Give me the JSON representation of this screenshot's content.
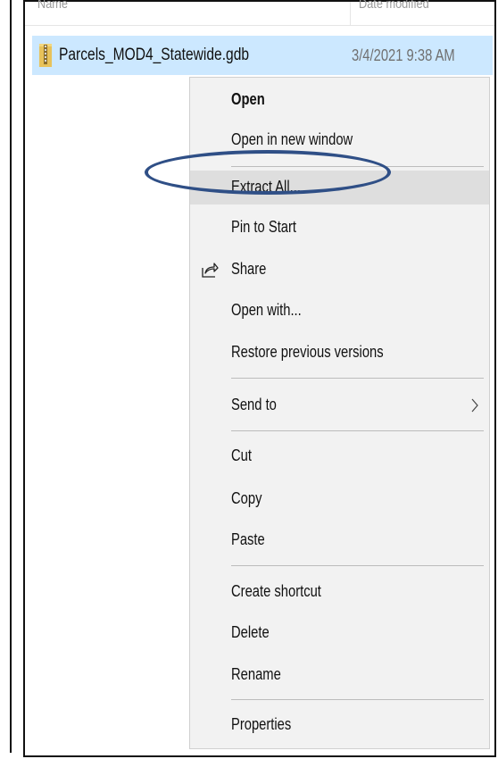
{
  "header": {
    "name_label": "Name",
    "date_label": "Date modified"
  },
  "file": {
    "name": "Parcels_MOD4_Statewide.gdb",
    "date": "3/4/2021 9:38 AM",
    "icon": "zip-folder-icon"
  },
  "menu": {
    "open": "Open",
    "open_new_window": "Open in new window",
    "extract_all": "Extract All...",
    "pin_to_start": "Pin to Start",
    "share": "Share",
    "open_with": "Open with...",
    "restore_previous": "Restore previous versions",
    "send_to": "Send to",
    "cut": "Cut",
    "copy": "Copy",
    "paste": "Paste",
    "create_shortcut": "Create shortcut",
    "delete": "Delete",
    "rename": "Rename",
    "properties": "Properties"
  },
  "colors": {
    "selection": "#cce8ff",
    "menu_background": "#f2f2f2",
    "menu_hover": "#dedede",
    "annotation_oval": "#2f4f86"
  }
}
